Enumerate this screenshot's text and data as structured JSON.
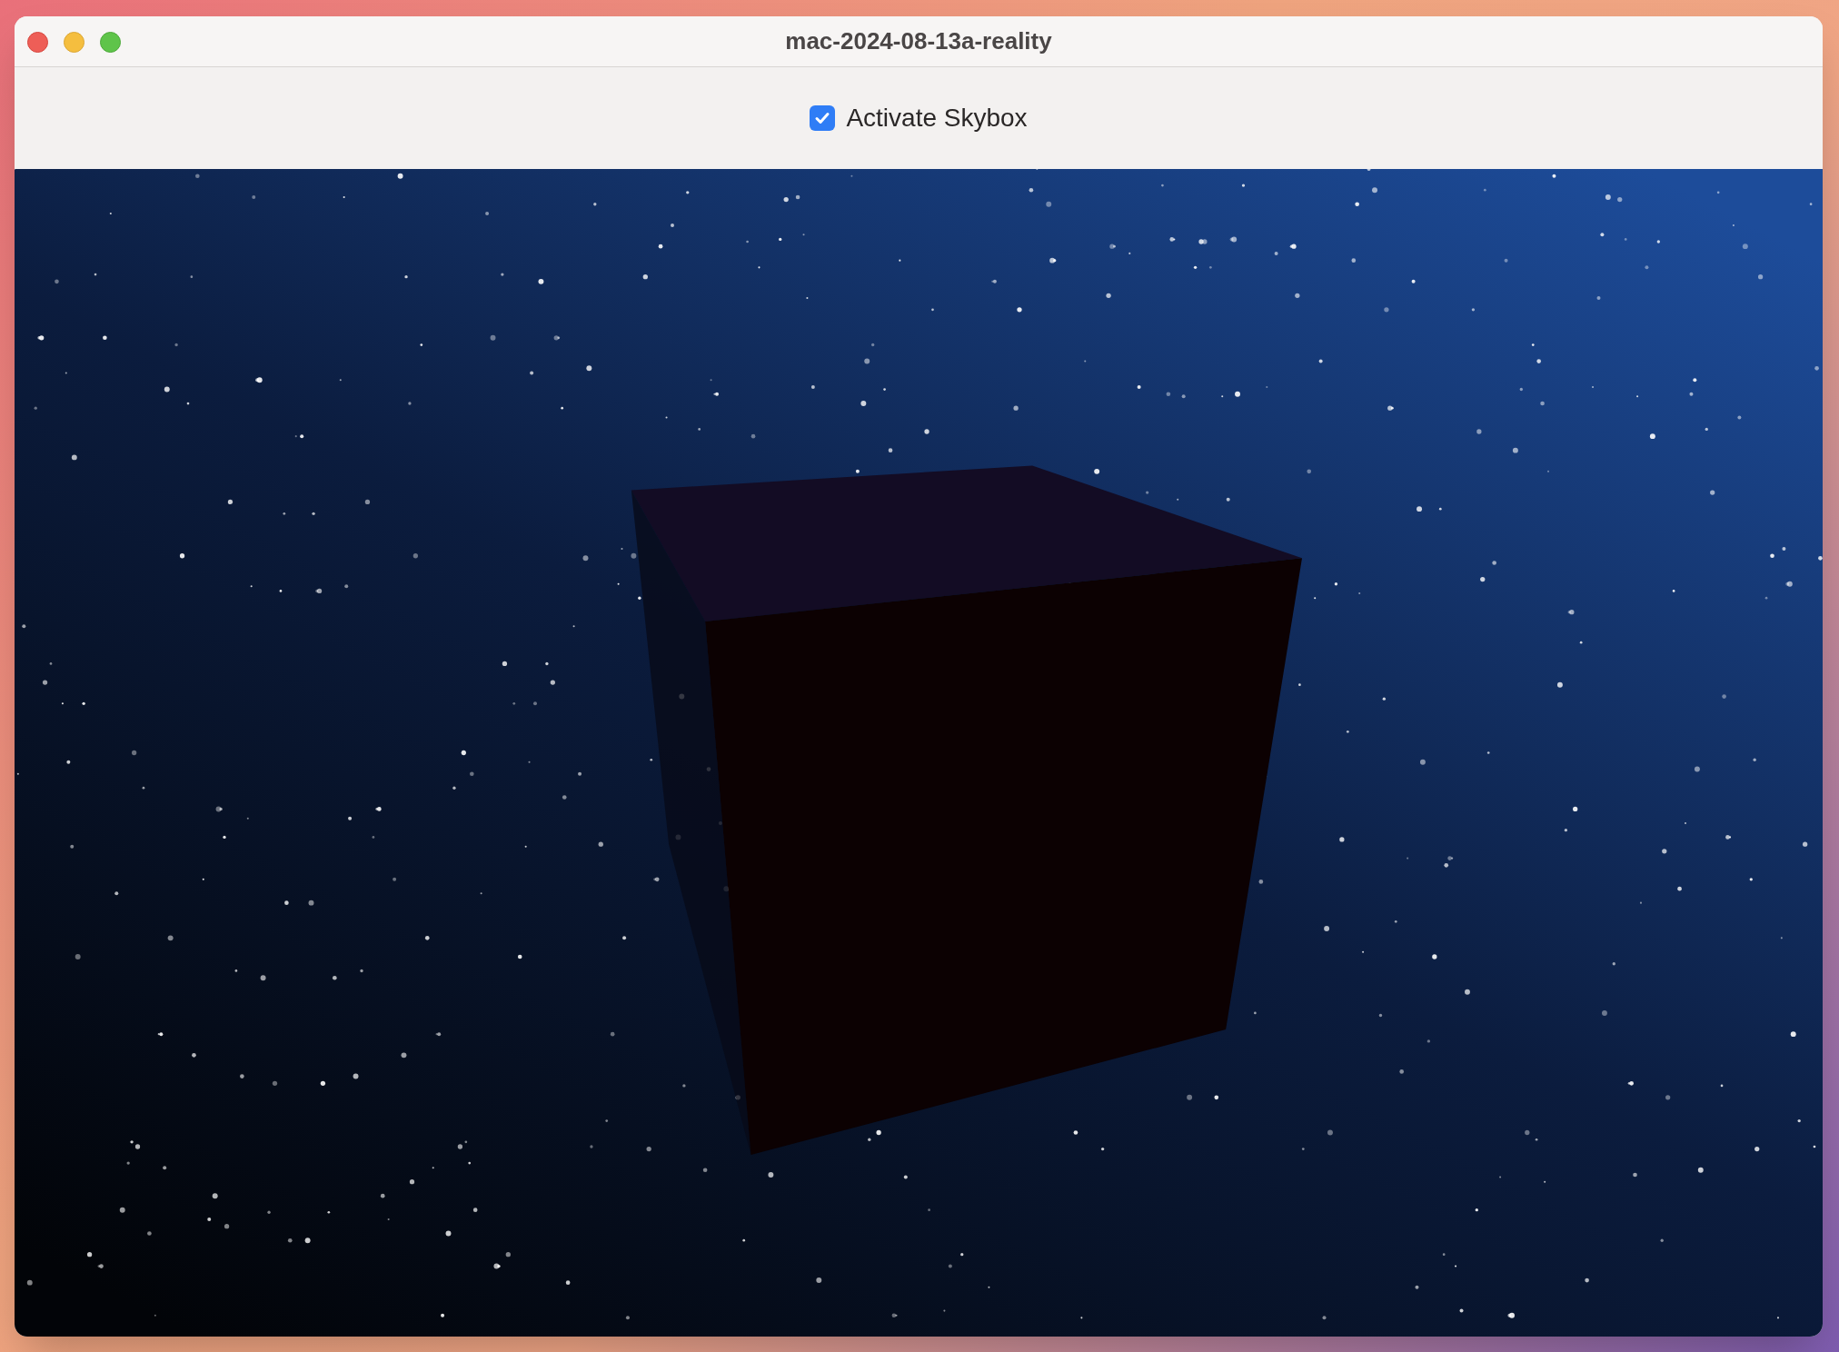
{
  "window": {
    "title": "mac-2024-08-13a-reality"
  },
  "skybox_toggle": {
    "label": "Activate Skybox",
    "checked": true
  }
}
